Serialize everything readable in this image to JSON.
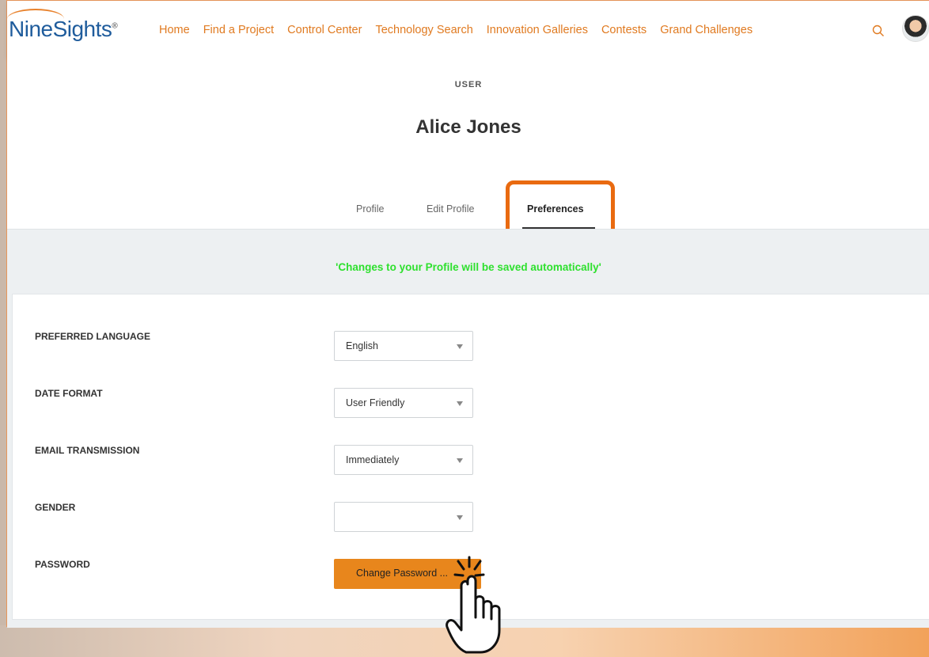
{
  "brand": {
    "logo_text": "NineSights",
    "logo_mark": "®"
  },
  "nav": {
    "links": [
      "Home",
      "Find a Project",
      "Control Center",
      "Technology Search",
      "Innovation Galleries",
      "Contests",
      "Grand Challenges"
    ]
  },
  "header": {
    "section_label": "USER",
    "user_name": "Alice Jones"
  },
  "tabs": {
    "profile": "Profile",
    "edit_profile": "Edit Profile",
    "preferences": "Preferences",
    "active": "Preferences"
  },
  "notice": "'Changes to your Profile will be saved automatically'",
  "form": {
    "preferred_language": {
      "label": "PREFERRED LANGUAGE",
      "value": "English"
    },
    "date_format": {
      "label": "DATE FORMAT",
      "value": "User Friendly"
    },
    "email_transmission": {
      "label": "EMAIL TRANSMISSION",
      "value": "Immediately"
    },
    "gender": {
      "label": "GENDER",
      "value": ""
    },
    "password": {
      "label": "PASSWORD",
      "button": "Change Password ..."
    }
  },
  "colors": {
    "accent": "#e07a20",
    "highlight": "#e96a10",
    "notice": "#2ee02e",
    "button": "#e8861c",
    "logo": "#1f5c9c"
  },
  "icons": {
    "search": "search-icon",
    "avatar": "avatar",
    "pointer": "pointer-hand-icon",
    "caret": "chevron-down-icon"
  }
}
